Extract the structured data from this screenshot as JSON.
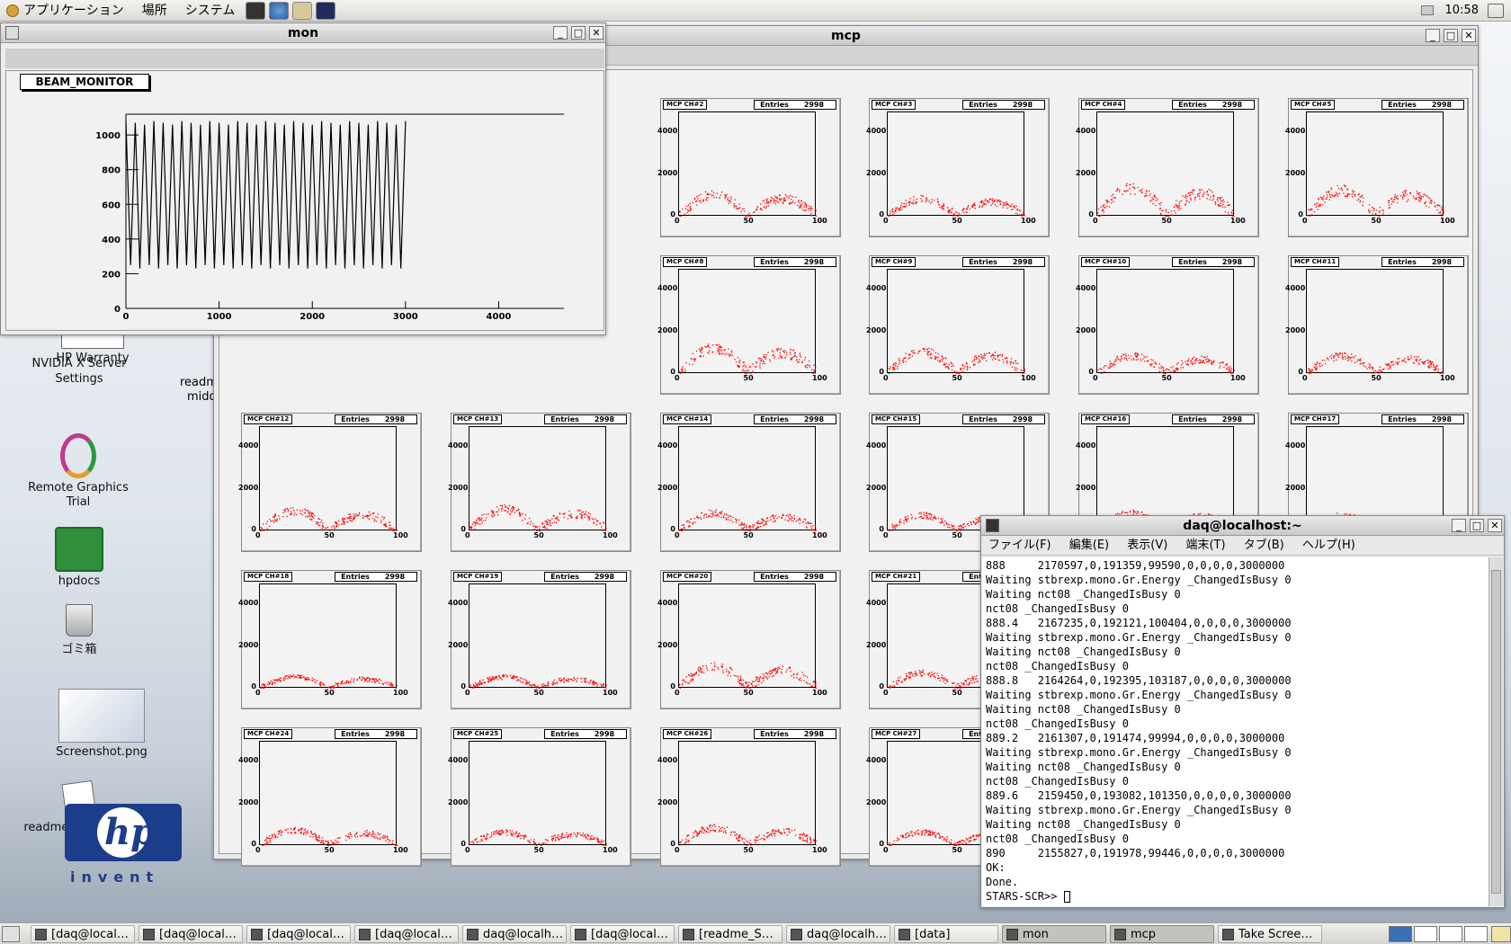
{
  "top_panel": {
    "menus": [
      "アプリケーション",
      "場所",
      "システム"
    ],
    "launchers": [
      "camera-icon",
      "browser-icon",
      "mail-icon",
      "terminal-icon"
    ],
    "clock": "10:58"
  },
  "desktop": {
    "icons": [
      {
        "label": "HP Warranty"
      },
      {
        "label": "NVIDIA X Server Settings"
      },
      {
        "label": "Remote Graphics Trial"
      },
      {
        "label": "hpdocs"
      },
      {
        "label": "ゴミ箱"
      },
      {
        "label": "Screenshot.png"
      },
      {
        "label": "readme_STARS.odt"
      }
    ],
    "partial_labels": [
      "readm",
      "midd"
    ],
    "logo_text": "invent"
  },
  "mon_window": {
    "title": "mon",
    "canvas_title": "BEAM_MONITOR",
    "chart_data": {
      "type": "line",
      "title": "BEAM_MONITOR",
      "xlim": [
        0,
        4700
      ],
      "ylim": [
        0,
        1120
      ],
      "x_ticks": [
        "0",
        "1000",
        "2000",
        "3000",
        "4000"
      ],
      "y_ticks": [
        "0",
        "200",
        "400",
        "600",
        "800",
        "1000"
      ],
      "oscillation_period": 100,
      "x_end": 3000,
      "y_min": 220,
      "y_max": 1080,
      "series": [
        {
          "color": "#000000"
        }
      ]
    }
  },
  "mcp_window": {
    "title": "mcp",
    "pads": [
      {
        "name": "MCP CH#2",
        "entries": "2998",
        "amp": 1000
      },
      {
        "name": "MCP CH#3",
        "entries": "2998",
        "amp": 800
      },
      {
        "name": "MCP CH#4",
        "entries": "2998",
        "amp": 1300
      },
      {
        "name": "MCP CH#5",
        "entries": "2998",
        "amp": 1200
      },
      {
        "name": "MCP CH#8",
        "entries": "2998",
        "amp": 1200
      },
      {
        "name": "MCP CH#9",
        "entries": "2998",
        "amp": 1000
      },
      {
        "name": "MCP CH#10",
        "entries": "2998",
        "amp": 800
      },
      {
        "name": "MCP CH#11",
        "entries": "2998",
        "amp": 800
      },
      {
        "name": "MCP CH#12",
        "entries": "2998",
        "amp": 900
      },
      {
        "name": "MCP CH#13",
        "entries": "2998",
        "amp": 1000
      },
      {
        "name": "MCP CH#14",
        "entries": "2998",
        "amp": 800
      },
      {
        "name": "MCP CH#15",
        "entries": "2998",
        "amp": 700
      },
      {
        "name": "MCP CH#16",
        "entries": "2998",
        "amp": 800
      },
      {
        "name": "MCP CH#17",
        "entries": "2998",
        "amp": 700
      },
      {
        "name": "MCP CH#18",
        "entries": "2998",
        "amp": 500
      },
      {
        "name": "MCP CH#19",
        "entries": "2998",
        "amp": 500
      },
      {
        "name": "MCP CH#20",
        "entries": "2998",
        "amp": 1000
      },
      {
        "name": "MCP CH#21",
        "entries": "2998",
        "amp": 700
      },
      {
        "name": "MCP CH#24",
        "entries": "2998",
        "amp": 700
      },
      {
        "name": "MCP CH#25",
        "entries": "2998",
        "amp": 600
      },
      {
        "name": "MCP CH#26",
        "entries": "2998",
        "amp": 800
      },
      {
        "name": "MCP CH#27",
        "entries": "2998",
        "amp": 600
      }
    ],
    "stats_label": "Entries",
    "y_ticks": [
      "0",
      "2000",
      "4000"
    ],
    "x_ticks": [
      "0",
      "50",
      "100"
    ]
  },
  "terminal": {
    "title": "daq@localhost:~",
    "menus": [
      "ファイル(F)",
      "編集(E)",
      "表示(V)",
      "端末(T)",
      "タブ(B)",
      "ヘルプ(H)"
    ],
    "lines": [
      "888     2170597,0,191359,99590,0,0,0,0,3000000",
      "Waiting stbrexp.mono.Gr.Energy _ChangedIsBusy 0",
      "Waiting nct08 _ChangedIsBusy 0",
      "nct08 _ChangedIsBusy 0",
      "888.4   2167235,0,192121,100404,0,0,0,0,3000000",
      "Waiting stbrexp.mono.Gr.Energy _ChangedIsBusy 0",
      "Waiting nct08 _ChangedIsBusy 0",
      "nct08 _ChangedIsBusy 0",
      "888.8   2164264,0,192395,103187,0,0,0,0,3000000",
      "Waiting stbrexp.mono.Gr.Energy _ChangedIsBusy 0",
      "Waiting nct08 _ChangedIsBusy 0",
      "nct08 _ChangedIsBusy 0",
      "889.2   2161307,0,191474,99994,0,0,0,0,3000000",
      "Waiting stbrexp.mono.Gr.Energy _ChangedIsBusy 0",
      "Waiting nct08 _ChangedIsBusy 0",
      "nct08 _ChangedIsBusy 0",
      "889.6   2159450,0,193082,101350,0,0,0,0,3000000",
      "Waiting stbrexp.mono.Gr.Energy _ChangedIsBusy 0",
      "Waiting nct08 _ChangedIsBusy 0",
      "nct08 _ChangedIsBusy 0",
      "890     2155827,0,191978,99446,0,0,0,0,3000000",
      "OK:",
      "Done.",
      "STARS-SCR>> "
    ]
  },
  "taskbar": {
    "tasks": [
      {
        "label": "[daq@local…"
      },
      {
        "label": "[daq@local…"
      },
      {
        "label": "[daq@local…"
      },
      {
        "label": "[daq@local…"
      },
      {
        "label": "daq@localh…"
      },
      {
        "label": "[daq@local…"
      },
      {
        "label": "[readme_S…"
      },
      {
        "label": "daq@localh…"
      },
      {
        "label": "[data]"
      },
      {
        "label": "mon"
      },
      {
        "label": "mcp"
      },
      {
        "label": "Take Scree…"
      }
    ]
  }
}
